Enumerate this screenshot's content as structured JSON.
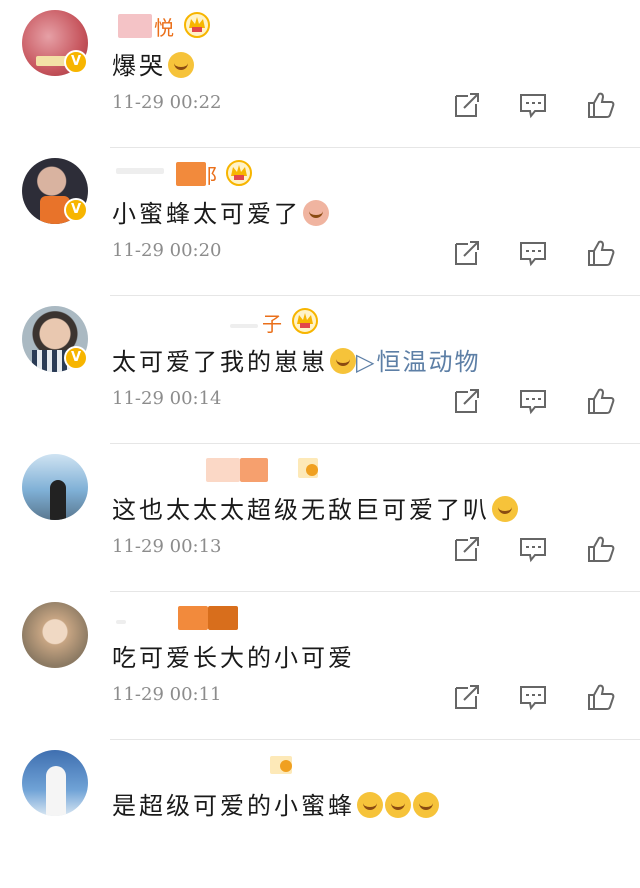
{
  "comments": [
    {
      "name_suffix": "悦",
      "text": "爆哭",
      "time": "11-29 00:22",
      "emojis": [
        "loudly-crying-emoji"
      ],
      "avatar_color": "#c7565e",
      "verified": true
    },
    {
      "name_suffix": "阝",
      "text": "小蜜蜂太可爱了",
      "time": "11-29 00:20",
      "emojis": [
        "pig-blush-emoji"
      ],
      "avatar_color": "#3a3a48",
      "verified": true
    },
    {
      "name_suffix": "子",
      "text": "太可爱了我的崽崽",
      "time": "11-29 00:14",
      "emojis": [
        "crying-emoji"
      ],
      "link": "▷恒温动物",
      "avatar_color": "#6e8a9a",
      "verified": true
    },
    {
      "name_suffix": "",
      "text": "这也太太太超级无敌巨可爱了叭",
      "time": "11-29 00:13",
      "emojis": [
        "surprised-emoji"
      ],
      "avatar_color": "#6fa0c7",
      "verified": false
    },
    {
      "name_suffix": "",
      "text": "吃可爱长大的小可爱",
      "time": "11-29 00:11",
      "emojis": [],
      "avatar_color": "#a9927a",
      "verified": false
    },
    {
      "name_suffix": "",
      "text": "是超级可爱的小蜜蜂",
      "time": "",
      "emojis": [
        "pleading-emoji",
        "pleading-emoji",
        "pleading-emoji"
      ],
      "avatar_color": "#5c86b8",
      "verified": false
    }
  ],
  "colors": {
    "accent": "#ea6f1a",
    "link": "#5d7fa6",
    "time": "#8c8c8c",
    "crown": "#f7b500"
  },
  "icons": {
    "share": "share-icon",
    "reply": "comment-icon",
    "like": "thumbs-up-icon"
  }
}
